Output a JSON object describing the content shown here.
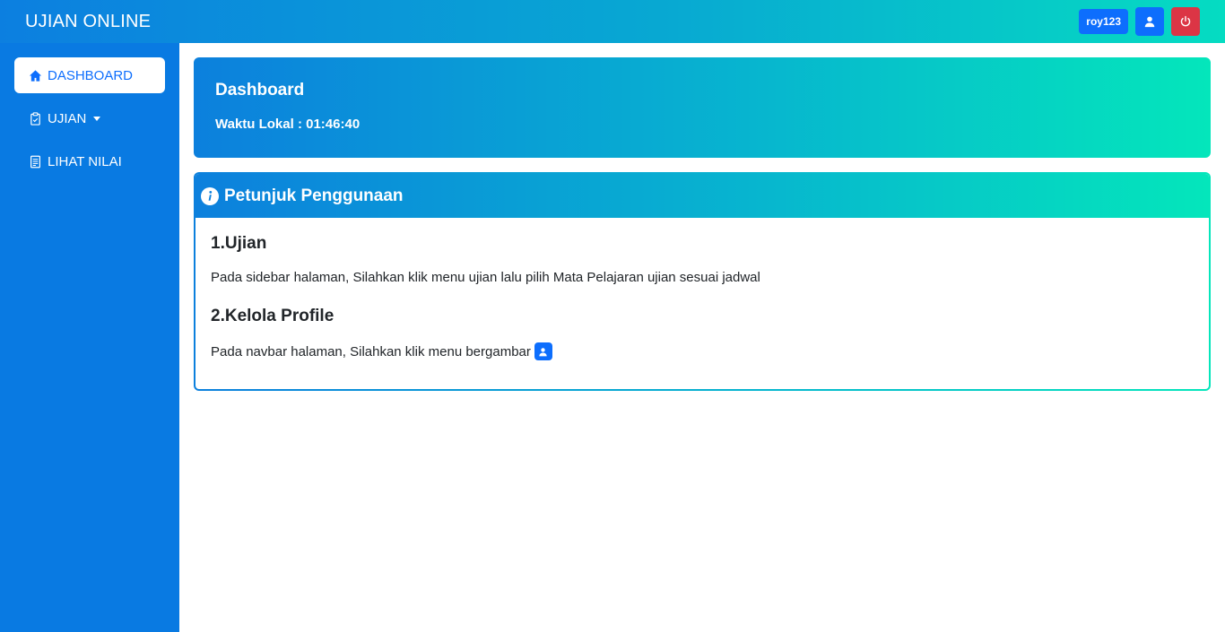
{
  "navbar": {
    "brand": "UJIAN ONLINE",
    "username": "roy123",
    "profile_icon": "user-icon",
    "logout_icon": "power-icon"
  },
  "sidebar": {
    "items": [
      {
        "label": "DASHBOARD",
        "icon": "home-icon",
        "active": true
      },
      {
        "label": "UJIAN",
        "icon": "clipboard-icon",
        "active": false
      },
      {
        "label": "LIHAT NILAI",
        "icon": "document-icon",
        "active": false
      }
    ]
  },
  "dashboard": {
    "title": "Dashboard",
    "local_time": "Waktu Lokal : 01:46:40"
  },
  "guide": {
    "title": "Petunjuk Penggunaan",
    "sections": [
      {
        "heading": "1.Ujian",
        "text": "Pada sidebar halaman, Silahkan klik menu ujian lalu pilih Mata Pelajaran ujian sesuai jadwal"
      },
      {
        "heading": "2.Kelola Profile",
        "text": "Pada navbar halaman, Silahkan klik menu bergambar"
      }
    ]
  },
  "colors": {
    "primary": "#0d6efd",
    "danger": "#dc3545",
    "sidebar": "#097ae2",
    "gradient_start": "#0c80dd",
    "gradient_end": "#04e6bb"
  }
}
